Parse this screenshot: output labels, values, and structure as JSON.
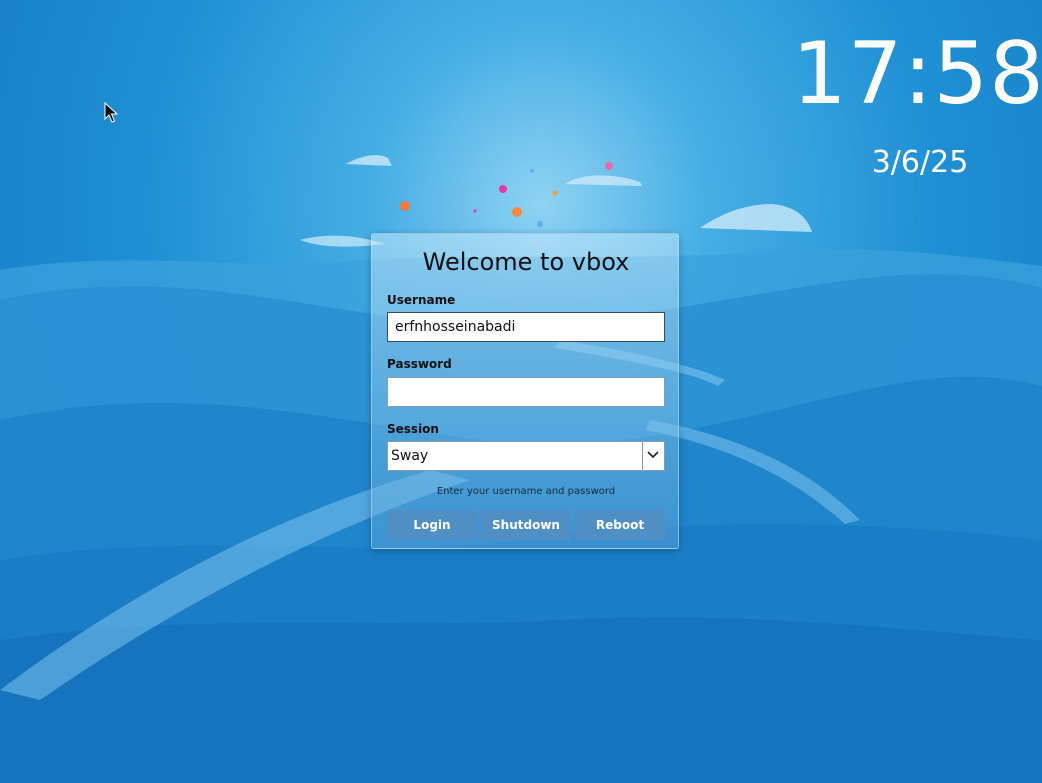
{
  "clock": {
    "time": "17:58",
    "date": "3/6/25"
  },
  "login": {
    "title": "Welcome to vbox",
    "username_label": "Username",
    "username_value": "erfnhosseinabadi",
    "password_label": "Password",
    "password_value": "",
    "session_label": "Session",
    "session_value": "Sway",
    "message": "Enter your username and password",
    "buttons": {
      "login": "Login",
      "shutdown": "Shutdown",
      "reboot": "Reboot"
    }
  },
  "icons": {
    "cursor": "mouse-pointer-icon",
    "dropdown": "chevron-down-icon"
  },
  "colors": {
    "wallpaper_sky": "#2a9ad9",
    "button": "#4f8fc4",
    "text": "#111111"
  }
}
